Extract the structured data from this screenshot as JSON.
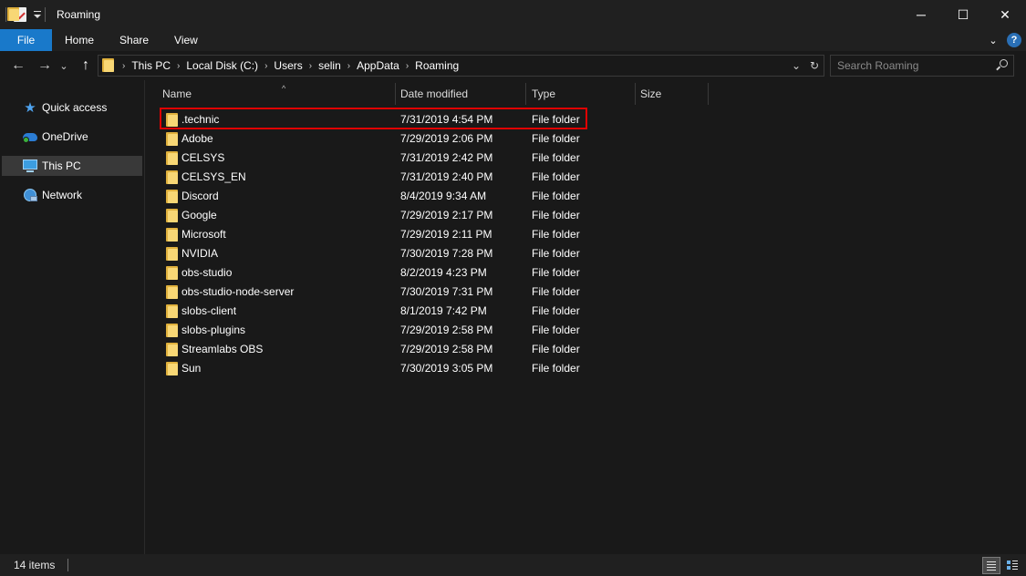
{
  "window": {
    "title": "Roaming",
    "minimize_glyph": "─",
    "maximize_glyph": "☐",
    "close_glyph": "✕"
  },
  "ribbon": {
    "tabs": [
      "File",
      "Home",
      "Share",
      "View"
    ],
    "expand_glyph": "⌄",
    "help_glyph": "?"
  },
  "nav": {
    "back_glyph": "←",
    "forward_glyph": "→",
    "recent_glyph": "⌄",
    "up_glyph": "↑",
    "crumbs": [
      "This PC",
      "Local Disk (C:)",
      "Users",
      "selin",
      "AppData",
      "Roaming"
    ],
    "crumb_sep": "›",
    "history_glyph": "⌄",
    "refresh_glyph": "↻"
  },
  "search": {
    "placeholder": "Search Roaming"
  },
  "sidebar": {
    "items": [
      {
        "label": "Quick access",
        "icon": "star-icon"
      },
      {
        "label": "OneDrive",
        "icon": "onedrive-icon"
      },
      {
        "label": "This PC",
        "icon": "this-pc-icon",
        "selected": true
      },
      {
        "label": "Network",
        "icon": "network-icon"
      }
    ]
  },
  "columns": {
    "name": "Name",
    "date": "Date modified",
    "type": "Type",
    "size": "Size",
    "sort_glyph": "^"
  },
  "files": [
    {
      "name": ".technic",
      "date": "7/31/2019 4:54 PM",
      "type": "File folder"
    },
    {
      "name": "Adobe",
      "date": "7/29/2019 2:06 PM",
      "type": "File folder"
    },
    {
      "name": "CELSYS",
      "date": "7/31/2019 2:42 PM",
      "type": "File folder"
    },
    {
      "name": "CELSYS_EN",
      "date": "7/31/2019 2:40 PM",
      "type": "File folder"
    },
    {
      "name": "Discord",
      "date": "8/4/2019 9:34 AM",
      "type": "File folder"
    },
    {
      "name": "Google",
      "date": "7/29/2019 2:17 PM",
      "type": "File folder"
    },
    {
      "name": "Microsoft",
      "date": "7/29/2019 2:11 PM",
      "type": "File folder"
    },
    {
      "name": "NVIDIA",
      "date": "7/30/2019 7:28 PM",
      "type": "File folder"
    },
    {
      "name": "obs-studio",
      "date": "8/2/2019 4:23 PM",
      "type": "File folder"
    },
    {
      "name": "obs-studio-node-server",
      "date": "7/30/2019 7:31 PM",
      "type": "File folder"
    },
    {
      "name": "slobs-client",
      "date": "8/1/2019 7:42 PM",
      "type": "File folder"
    },
    {
      "name": "slobs-plugins",
      "date": "7/29/2019 2:58 PM",
      "type": "File folder"
    },
    {
      "name": "Streamlabs OBS",
      "date": "7/29/2019 2:58 PM",
      "type": "File folder"
    },
    {
      "name": "Sun",
      "date": "7/30/2019 3:05 PM",
      "type": "File folder"
    }
  ],
  "status": {
    "item_count": "14 items"
  },
  "colors": {
    "accent": "#1979ca",
    "highlight_box": "#e00000",
    "folder": "#f8d775"
  }
}
